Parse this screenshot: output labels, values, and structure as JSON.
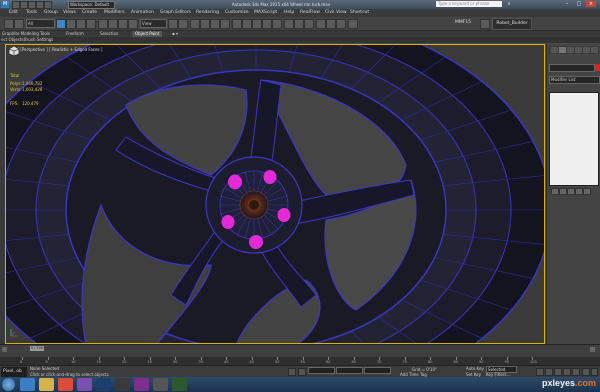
{
  "titlebar": {
    "workspace": "Workspace: Default",
    "title": "Autodesk 3ds Max 2015 x64     Wheel rim turb.max",
    "search_placeholder": "Type a keyword or phrase"
  },
  "menu": [
    "Edit",
    "Tools",
    "Group",
    "Views",
    "Create",
    "Modifiers",
    "Animation",
    "Graph Editors",
    "Rendering",
    "Customize",
    "MAXScript",
    "Help",
    "RealFlow",
    "Civil View",
    "Shortcut"
  ],
  "toolbar": {
    "filter_value": "All",
    "view_value": "View",
    "mmf_label": "MMF15",
    "robot_label": "Robot_Builder"
  },
  "ribbon": {
    "tabs": [
      "Graphite Modeling Tools",
      "Freeform",
      "Selection",
      "Object Paint"
    ],
    "active_tab": "Object Paint",
    "sub": [
      "ect Objects",
      "Brush Settings"
    ]
  },
  "viewport": {
    "label": "[ + ] [Perspective ] [ Realistic + Edged Faces ]",
    "stats": {
      "total_label": "Total",
      "polys_label": "Polys:",
      "polys_value": "1,946,782",
      "verts_label": "Verts:",
      "verts_value": "1,003,428",
      "fps_label": "FPS:",
      "fps_value": "120.479"
    },
    "accent_edges": "#3d37c6",
    "accent_lugs": "#e32ad6"
  },
  "command_panel": {
    "modifier_list": "Modifier List"
  },
  "timeline": {
    "scrubber": "0 / 100",
    "ticks": [
      "0",
      "5",
      "10",
      "15",
      "20",
      "25",
      "30",
      "35",
      "40",
      "45",
      "50",
      "55",
      "60",
      "65",
      "70",
      "75",
      "80",
      "85",
      "90",
      "95",
      "100"
    ]
  },
  "status": {
    "maxscript_label": "Pixel, ob",
    "line1": "None Selected",
    "line2": "Click or click-and-drag to select objects",
    "grid": "Grid = 0'10\"",
    "auto_key": "Auto Key",
    "selected": "Selected",
    "add_time_tag": "Add Time Tag",
    "set_key": "Set Key",
    "key_filters": "Key Filters..."
  },
  "taskbar": {
    "brand_main": "pxleyes",
    "brand_tld": ".com"
  }
}
